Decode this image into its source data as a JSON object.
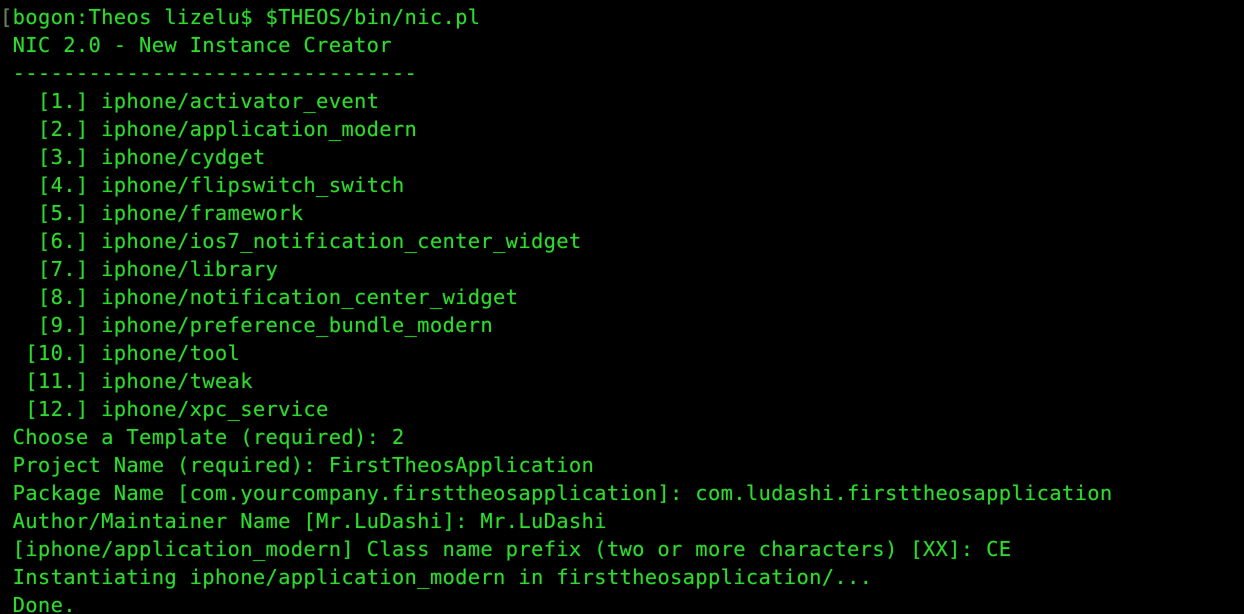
{
  "terminal": {
    "app": "Terminal",
    "colors": {
      "background": "#000000",
      "foreground": "#2fd92f",
      "prompt_bracket": "#6e7a6e"
    },
    "prompt": {
      "bracket": "[",
      "host": "bogon",
      "cwd": "Theos",
      "user": "lizelu",
      "sigil": "$",
      "command": "$THEOS/bin/nic.pl",
      "full": "[bogon:Theos lizelu$ $THEOS/bin/nic.pl"
    },
    "program": {
      "title": "NIC 2.0 - New Instance Creator",
      "separator": "--------------------------------"
    },
    "templates": [
      {
        "index": "[1.]",
        "name": "iphone/activator_event"
      },
      {
        "index": "[2.]",
        "name": "iphone/application_modern"
      },
      {
        "index": "[3.]",
        "name": "iphone/cydget"
      },
      {
        "index": "[4.]",
        "name": "iphone/flipswitch_switch"
      },
      {
        "index": "[5.]",
        "name": "iphone/framework"
      },
      {
        "index": "[6.]",
        "name": "iphone/ios7_notification_center_widget"
      },
      {
        "index": "[7.]",
        "name": "iphone/library"
      },
      {
        "index": "[8.]",
        "name": "iphone/notification_center_widget"
      },
      {
        "index": "[9.]",
        "name": "iphone/preference_bundle_modern"
      },
      {
        "index": "[10.]",
        "name": "iphone/tool"
      },
      {
        "index": "[11.]",
        "name": "iphone/tweak"
      },
      {
        "index": "[12.]",
        "name": "iphone/xpc_service"
      }
    ],
    "template_lines": [
      "   [1.] iphone/activator_event",
      "   [2.] iphone/application_modern",
      "   [3.] iphone/cydget",
      "   [4.] iphone/flipswitch_switch",
      "   [5.] iphone/framework",
      "   [6.] iphone/ios7_notification_center_widget",
      "   [7.] iphone/library",
      "   [8.] iphone/notification_center_widget",
      "   [9.] iphone/preference_bundle_modern",
      "  [10.] iphone/tool",
      "  [11.] iphone/tweak",
      "  [12.] iphone/xpc_service"
    ],
    "prompts": [
      {
        "label": "Choose a Template (required):",
        "default": "",
        "answer": "2",
        "full": " Choose a Template (required): 2"
      },
      {
        "label": "Project Name (required):",
        "default": "",
        "answer": "FirstTheosApplication",
        "full": " Project Name (required): FirstTheosApplication"
      },
      {
        "label": "Package Name",
        "default": "[com.yourcompany.firsttheosapplication]",
        "answer": "com.ludashi.firsttheosapplication",
        "full": " Package Name [com.yourcompany.firsttheosapplication]: com.ludashi.firsttheosapplication"
      },
      {
        "label": "Author/Maintainer Name",
        "default": "[Mr.LuDashi]",
        "answer": "Mr.LuDashi",
        "full": " Author/Maintainer Name [Mr.LuDashi]: Mr.LuDashi"
      },
      {
        "label": "[iphone/application_modern] Class name prefix (two or more characters)",
        "default": "[XX]",
        "answer": "CE",
        "full": " [iphone/application_modern] Class name prefix (two or more characters) [XX]: CE"
      }
    ],
    "status": {
      "instantiating": " Instantiating iphone/application_modern in firsttheosapplication/...",
      "done": " Done."
    }
  }
}
